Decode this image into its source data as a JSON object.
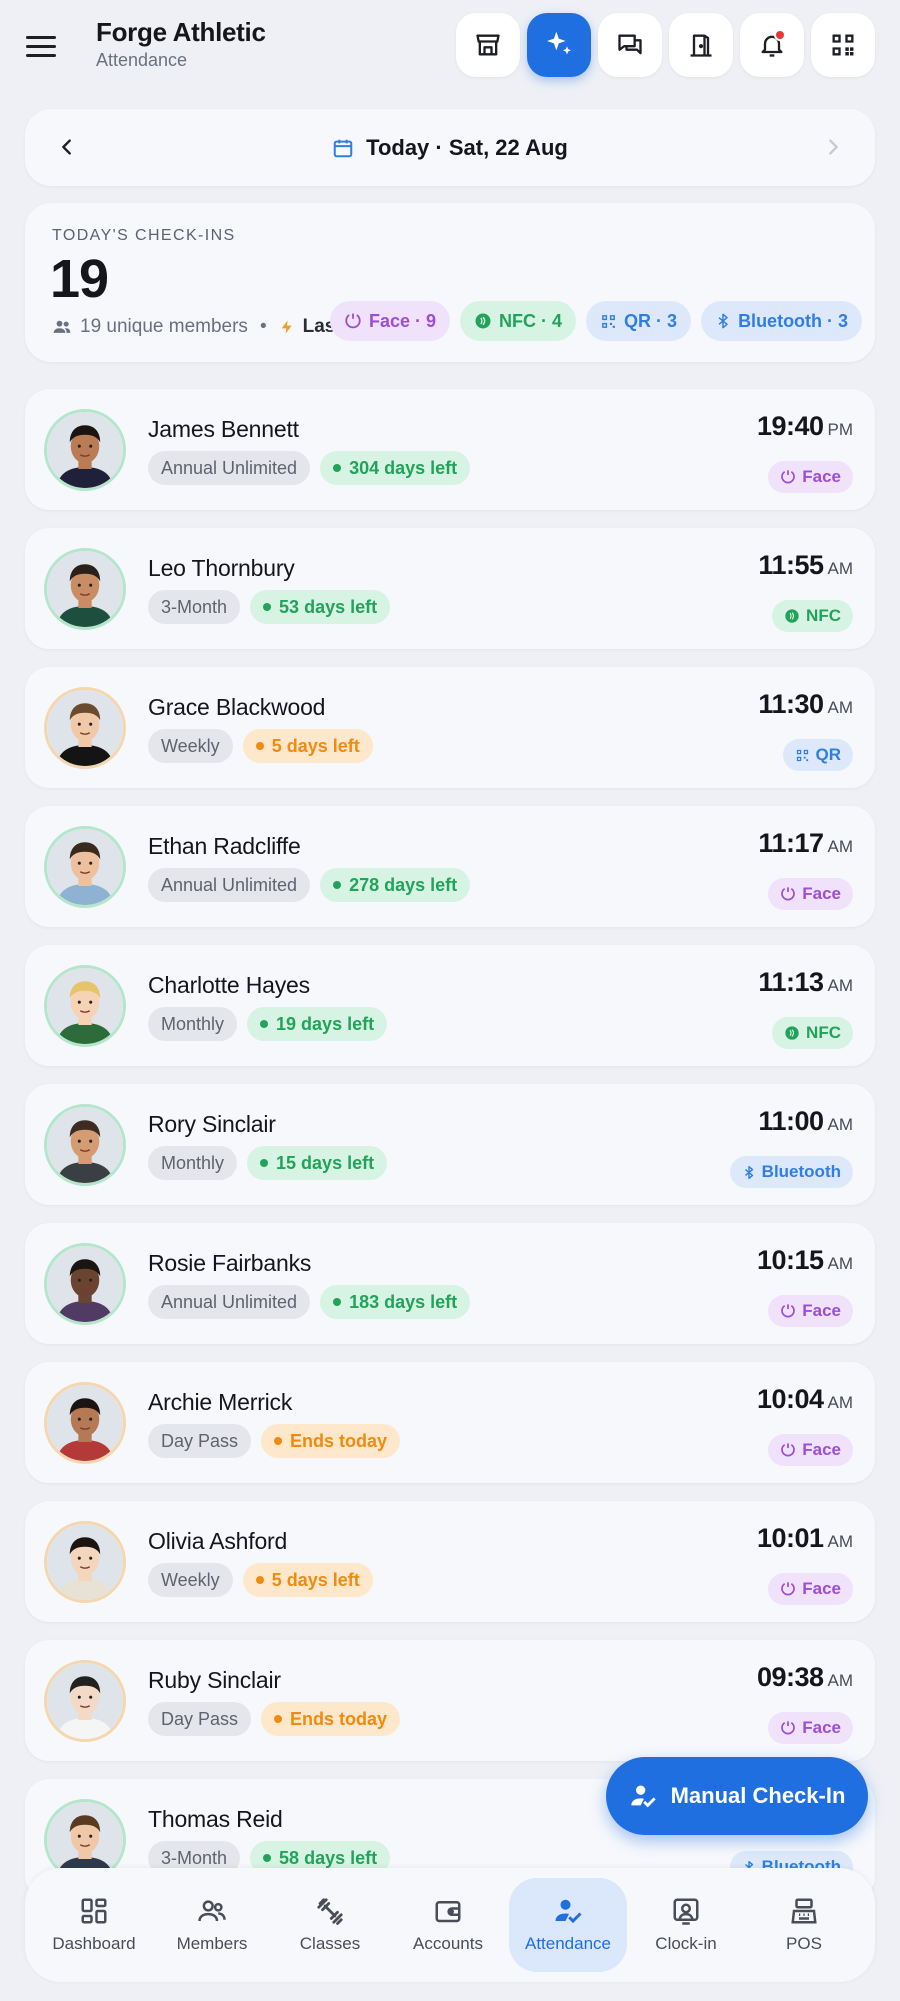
{
  "header": {
    "title": "Forge Athletic",
    "subtitle": "Attendance",
    "actions": [
      {
        "icon": "storefront-icon"
      },
      {
        "icon": "sparkle-icon",
        "active": true
      },
      {
        "icon": "chat-icon"
      },
      {
        "icon": "door-icon"
      },
      {
        "icon": "bell-icon",
        "badge": true
      },
      {
        "icon": "qr-code-icon"
      }
    ]
  },
  "date": {
    "label": "Today · Sat, 22 Aug"
  },
  "summary": {
    "label": "TODAY'S CHECK-INS",
    "count": "19",
    "unique": "19 unique members",
    "separator": "•",
    "last": "Last 19:40",
    "chips": [
      {
        "label": "Face · 9",
        "type": "face"
      },
      {
        "label": "NFC · 4",
        "type": "nfc"
      },
      {
        "label": "QR · 3",
        "type": "qr"
      },
      {
        "label": "Bluetooth · 3",
        "type": "bt"
      }
    ]
  },
  "checkins": [
    {
      "name": "James Bennett",
      "plan": "Annual Unlimited",
      "days": "304 days left",
      "status": "green",
      "time": "19:40",
      "ampm": "PM",
      "method": "Face",
      "method_type": "face"
    },
    {
      "name": "Leo Thornbury",
      "plan": "3-Month",
      "days": "53 days left",
      "status": "green",
      "time": "11:55",
      "ampm": "AM",
      "method": "NFC",
      "method_type": "nfc"
    },
    {
      "name": "Grace Blackwood",
      "plan": "Weekly",
      "days": "5 days left",
      "status": "amber",
      "time": "11:30",
      "ampm": "AM",
      "method": "QR",
      "method_type": "qr"
    },
    {
      "name": "Ethan Radcliffe",
      "plan": "Annual Unlimited",
      "days": "278 days left",
      "status": "green",
      "time": "11:17",
      "ampm": "AM",
      "method": "Face",
      "method_type": "face"
    },
    {
      "name": "Charlotte Hayes",
      "plan": "Monthly",
      "days": "19 days left",
      "status": "green",
      "time": "11:13",
      "ampm": "AM",
      "method": "NFC",
      "method_type": "nfc"
    },
    {
      "name": "Rory Sinclair",
      "plan": "Monthly",
      "days": "15 days left",
      "status": "green",
      "time": "11:00",
      "ampm": "AM",
      "method": "Bluetooth",
      "method_type": "bluetooth"
    },
    {
      "name": "Rosie Fairbanks",
      "plan": "Annual Unlimited",
      "days": "183 days left",
      "status": "green",
      "time": "10:15",
      "ampm": "AM",
      "method": "Face",
      "method_type": "face"
    },
    {
      "name": "Archie Merrick",
      "plan": "Day Pass",
      "days": "Ends today",
      "status": "amber",
      "time": "10:04",
      "ampm": "AM",
      "method": "Face",
      "method_type": "face"
    },
    {
      "name": "Olivia Ashford",
      "plan": "Weekly",
      "days": "5 days left",
      "status": "amber",
      "time": "10:01",
      "ampm": "AM",
      "method": "Face",
      "method_type": "face"
    },
    {
      "name": "Ruby Sinclair",
      "plan": "Day Pass",
      "days": "Ends today",
      "status": "amber",
      "time": "09:38",
      "ampm": "AM",
      "method": "Face",
      "method_type": "face"
    },
    {
      "name": "Thomas Reid",
      "plan": "3-Month",
      "days": "58 days left",
      "status": "green",
      "time": "",
      "ampm": "",
      "method": "Bluetooth",
      "method_type": "bluetooth"
    }
  ],
  "fab": {
    "label": "Manual Check-In"
  },
  "nav": [
    {
      "label": "Dashboard",
      "icon": "dashboard-icon"
    },
    {
      "label": "Members",
      "icon": "members-icon"
    },
    {
      "label": "Classes",
      "icon": "dumbbell-icon"
    },
    {
      "label": "Accounts",
      "icon": "wallet-icon"
    },
    {
      "label": "Attendance",
      "icon": "attendance-icon",
      "active": true
    },
    {
      "label": "Clock-in",
      "icon": "badge-icon"
    },
    {
      "label": "POS",
      "icon": "register-icon"
    }
  ],
  "colors": {
    "accent": "#1f6fe0",
    "background": "#eef0f5",
    "card": "#f7f8fc",
    "face": "#9c4fd6",
    "nfc": "#22a35a",
    "qr": "#2f7ee6",
    "warning": "#f08a10"
  }
}
